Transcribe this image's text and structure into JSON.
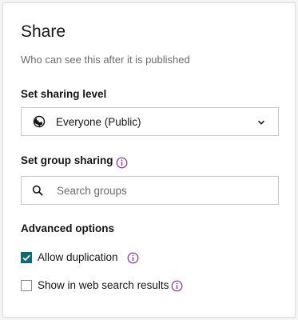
{
  "header": {
    "title": "Share",
    "subtitle": "Who can see this after it is published"
  },
  "sharing_level": {
    "label": "Set sharing level",
    "selected": "Everyone (Public)",
    "icon": "globe-icon"
  },
  "group_sharing": {
    "label": "Set group sharing",
    "search_placeholder": "Search groups",
    "search_value": ""
  },
  "advanced": {
    "label": "Advanced options",
    "options": [
      {
        "label": "Allow duplication",
        "checked": true
      },
      {
        "label": "Show in web search results",
        "checked": false
      }
    ]
  },
  "colors": {
    "accent": "#0b6b77",
    "info_icon": "#8a2ea0",
    "border": "#c8c8c8"
  }
}
